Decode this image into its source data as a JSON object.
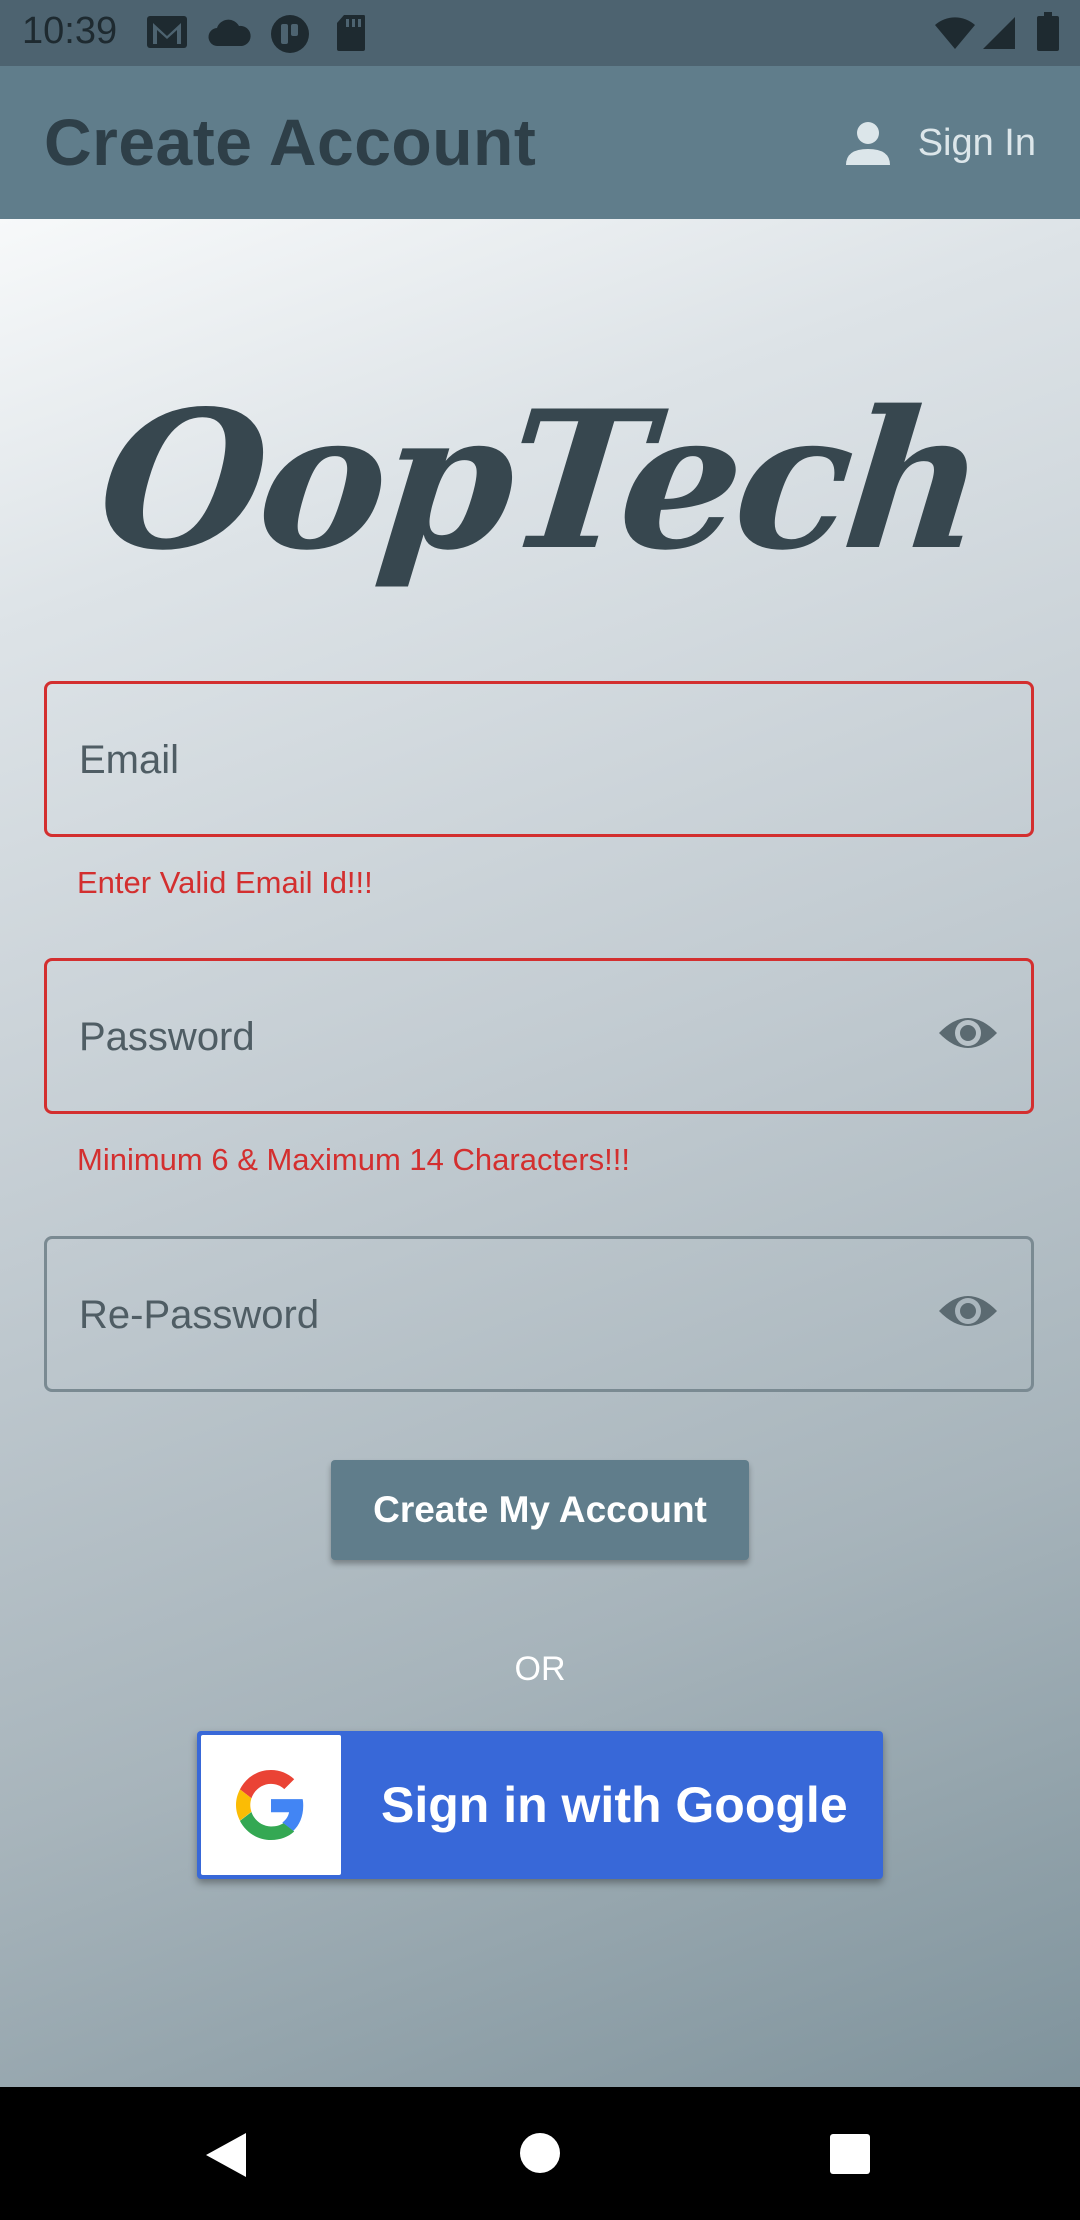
{
  "status_bar": {
    "time": "10:39",
    "left_icons": [
      "gmail-icon",
      "cloud-icon",
      "app-notification-icon",
      "sd-card-icon"
    ],
    "right_icons": [
      "wifi-icon",
      "signal-icon",
      "battery-icon"
    ]
  },
  "app_bar": {
    "title": "Create Account",
    "action_label": "Sign In",
    "action_icon": "person-icon",
    "color": "#607d8b"
  },
  "logo": {
    "text": "OopTech"
  },
  "form": {
    "email": {
      "placeholder": "Email",
      "value": "",
      "error": "Enter Valid Email Id!!!"
    },
    "password": {
      "placeholder": "Password",
      "value": "",
      "error": "Minimum 6 & Maximum 14 Characters!!!",
      "toggle_icon": "eye-icon"
    },
    "repassword": {
      "placeholder": "Re-Password",
      "value": "",
      "toggle_icon": "eye-icon"
    },
    "submit_label": "Create My Account",
    "error_color": "#d32f2f"
  },
  "divider_text": "OR",
  "google_button": {
    "label": "Sign in with Google",
    "color": "#3868d8",
    "icon": "google-g-icon"
  },
  "nav_bar": {
    "buttons": [
      "back-icon",
      "home-icon",
      "recents-icon"
    ]
  }
}
